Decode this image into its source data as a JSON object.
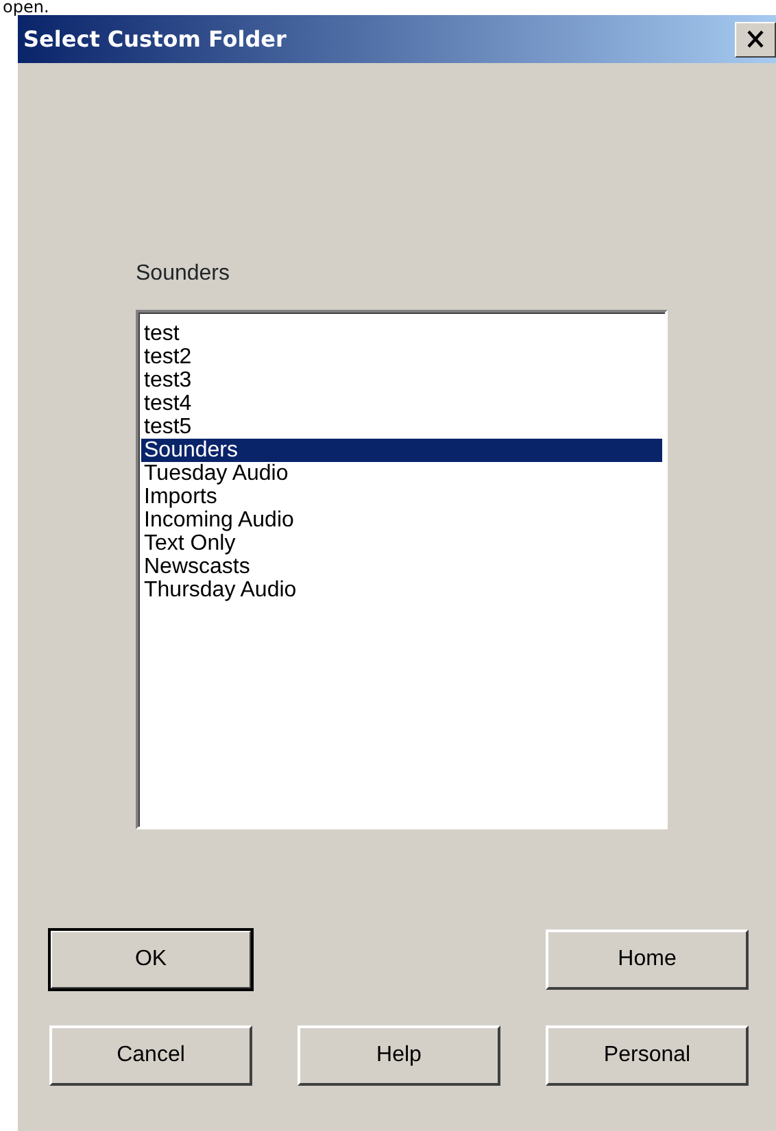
{
  "caption_fragment": "open.",
  "window": {
    "title": "Select Custom Folder"
  },
  "folder_label": "Sounders",
  "folders": [
    {
      "label": "test",
      "selected": false
    },
    {
      "label": "test2",
      "selected": false
    },
    {
      "label": "test3",
      "selected": false
    },
    {
      "label": "test4",
      "selected": false
    },
    {
      "label": "test5",
      "selected": false
    },
    {
      "label": "Sounders",
      "selected": true
    },
    {
      "label": "Tuesday Audio",
      "selected": false
    },
    {
      "label": "Imports",
      "selected": false
    },
    {
      "label": "Incoming Audio",
      "selected": false
    },
    {
      "label": "Text Only",
      "selected": false
    },
    {
      "label": "Newscasts",
      "selected": false
    },
    {
      "label": "Thursday Audio",
      "selected": false
    }
  ],
  "button_rows": [
    [
      {
        "label": "OK",
        "default": true
      },
      null,
      {
        "label": "Home",
        "default": false
      }
    ],
    [
      {
        "label": "Cancel",
        "default": false
      },
      {
        "label": "Help",
        "default": false
      },
      {
        "label": "Personal",
        "default": false
      }
    ]
  ]
}
